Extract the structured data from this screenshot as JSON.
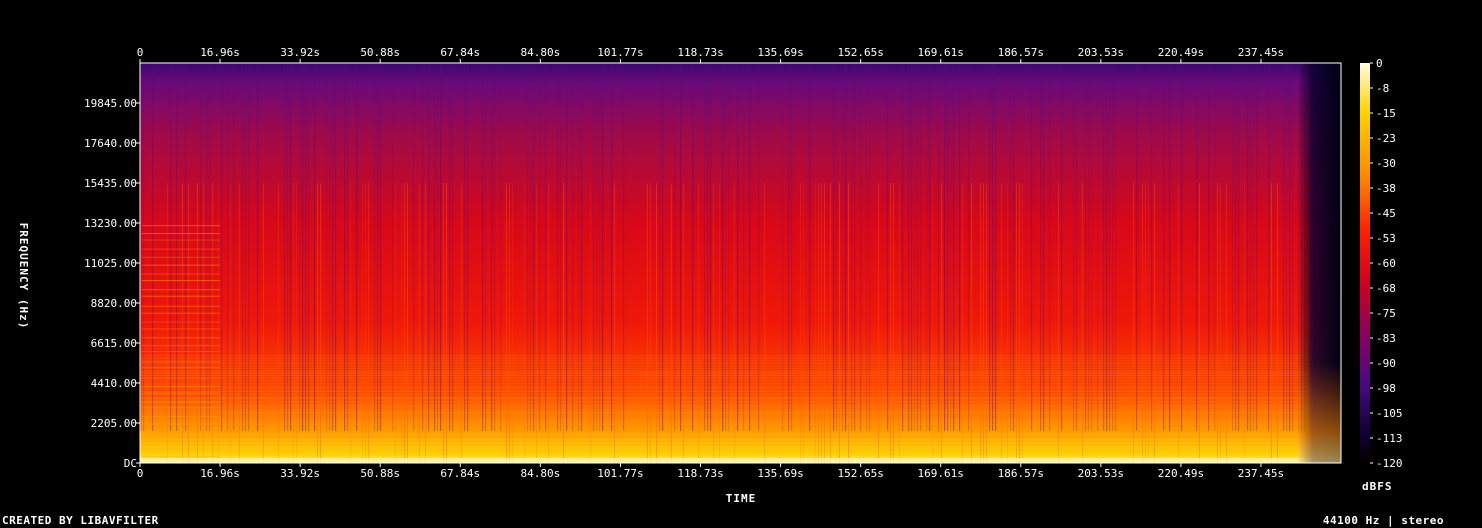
{
  "chart_data": {
    "type": "heatmap",
    "title": "",
    "xlabel": "TIME",
    "ylabel": "FREQUENCY (Hz)",
    "x_ticks": [
      "0",
      "16.96s",
      "33.92s",
      "50.88s",
      "67.84s",
      "84.80s",
      "101.77s",
      "118.73s",
      "135.69s",
      "152.65s",
      "169.61s",
      "186.57s",
      "203.53s",
      "220.49s",
      "237.45s"
    ],
    "x_tick_values": [
      0,
      16.96,
      33.92,
      50.88,
      67.84,
      84.8,
      101.77,
      118.73,
      135.69,
      152.65,
      169.61,
      186.57,
      203.53,
      220.49,
      237.45
    ],
    "xlim": [
      0,
      254.4
    ],
    "y_ticks": [
      "DC",
      "2205.00",
      "4410.00",
      "6615.00",
      "8820.00",
      "11025.00",
      "13230.00",
      "15435.00",
      "17640.00",
      "19845.00"
    ],
    "y_tick_values": [
      0,
      2205,
      4410,
      6615,
      8820,
      11025,
      13230,
      15435,
      17640,
      19845
    ],
    "ylim": [
      0,
      22050
    ],
    "colorbar": {
      "label": "dBFS",
      "ticks": [
        "0",
        "-8",
        "-15",
        "-23",
        "-30",
        "-38",
        "-45",
        "-53",
        "-60",
        "-68",
        "-75",
        "-83",
        "-90",
        "-98",
        "-105",
        "-113",
        "-120"
      ],
      "range": [
        -120,
        0
      ]
    },
    "audio_end_seconds": 248,
    "colors": [
      "#000000",
      "#1a0050",
      "#4a0a80",
      "#a00060",
      "#e00010",
      "#ff3000",
      "#ff8a00",
      "#ffd400",
      "#ffffd0"
    ]
  },
  "footer": {
    "left": "CREATED BY LIBAVFILTER",
    "right": "44100 Hz | stereo"
  }
}
